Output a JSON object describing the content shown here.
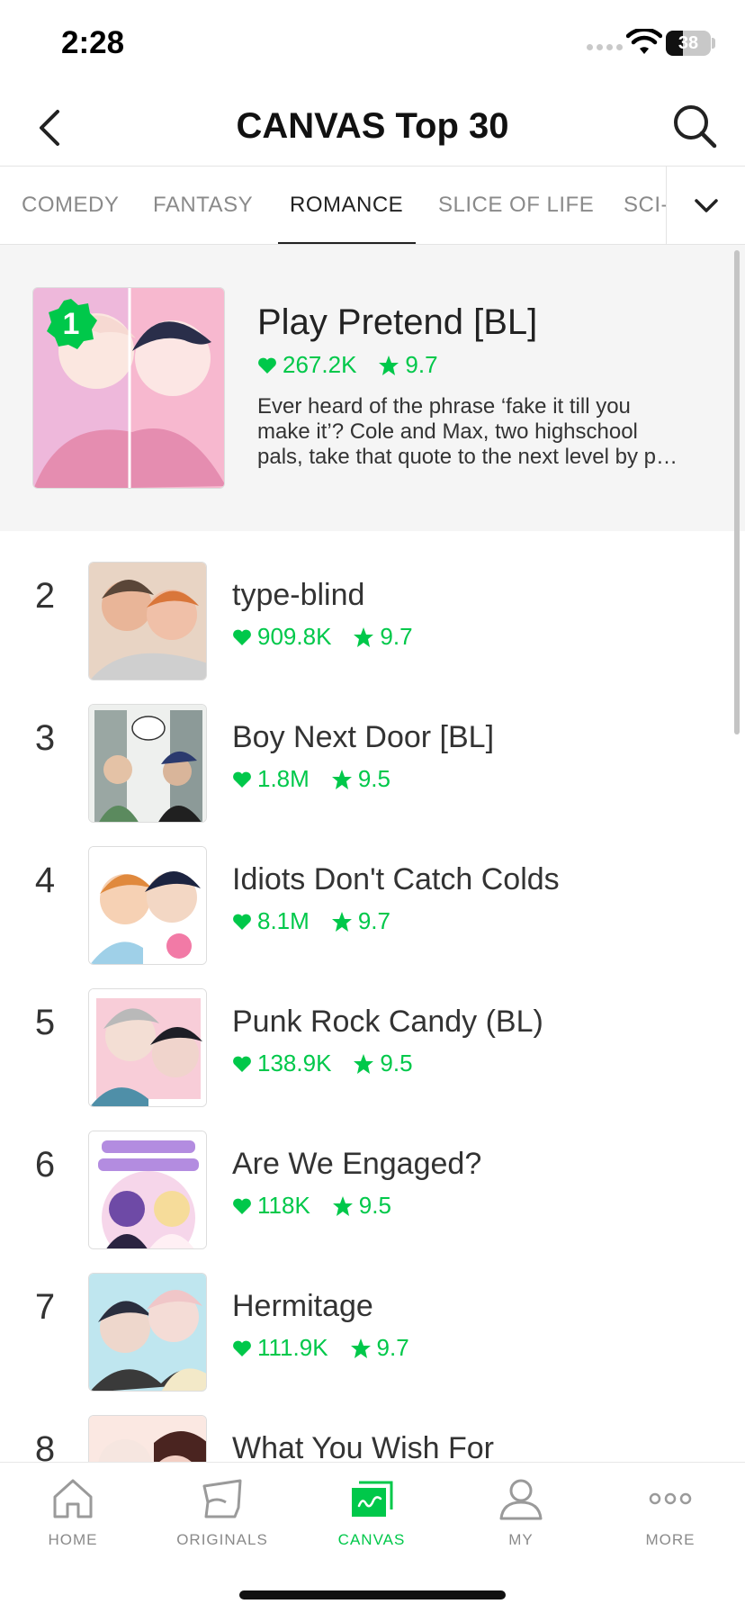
{
  "status_bar": {
    "time": "2:28",
    "battery": "38",
    "battery_level": 0.38
  },
  "header": {
    "title": "CANVAS Top 30"
  },
  "tabs": [
    {
      "label": "COMEDY"
    },
    {
      "label": "FANTASY"
    },
    {
      "label": "ROMANCE",
      "active": true
    },
    {
      "label": "SLICE OF LIFE"
    },
    {
      "label": "SCI-FI"
    }
  ],
  "featured": {
    "rank": "1",
    "title": "Play Pretend [BL]",
    "likes": "267.2K",
    "rating": "9.7",
    "description_lines": [
      "Ever heard of the phrase ‘fake it till you",
      "make it’? Cole and Max, two highschool",
      "pals, take that quote to the next level by p…"
    ]
  },
  "list": [
    {
      "rank": "2",
      "title": "type-blind",
      "likes": "909.8K",
      "rating": "9.7"
    },
    {
      "rank": "3",
      "title": "Boy Next Door [BL]",
      "likes": "1.8M",
      "rating": "9.5"
    },
    {
      "rank": "4",
      "title": "Idiots Don't Catch Colds",
      "likes": "8.1M",
      "rating": "9.7"
    },
    {
      "rank": "5",
      "title": "Punk Rock Candy (BL)",
      "likes": "138.9K",
      "rating": "9.5"
    },
    {
      "rank": "6",
      "title": "Are We Engaged?",
      "likes": "118K",
      "rating": "9.5"
    },
    {
      "rank": "7",
      "title": "Hermitage",
      "likes": "111.9K",
      "rating": "9.7"
    },
    {
      "rank": "8",
      "title": "What You Wish For",
      "likes": "",
      "rating": ""
    }
  ],
  "bottom_nav": [
    {
      "label": "HOME",
      "icon": "home-icon"
    },
    {
      "label": "ORIGINALS",
      "icon": "originals-icon"
    },
    {
      "label": "CANVAS",
      "icon": "canvas-icon",
      "active": true
    },
    {
      "label": "MY",
      "icon": "person-icon"
    },
    {
      "label": "MORE",
      "icon": "more-icon"
    }
  ],
  "colors": {
    "accent": "#00c84a",
    "text": "#222222",
    "muted": "#8a8a8a",
    "featured_bg": "#f5f5f5"
  }
}
